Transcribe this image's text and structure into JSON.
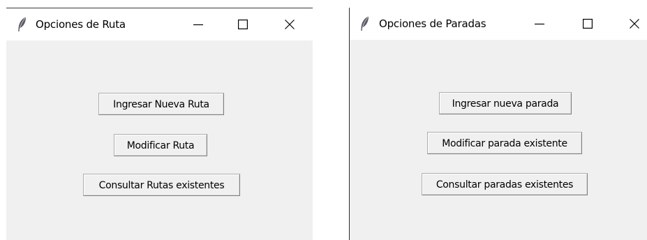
{
  "windows": [
    {
      "title": "Opciones de Ruta",
      "icon": "feather-icon",
      "controls": [
        "minimize-icon",
        "maximize-icon",
        "close-icon"
      ],
      "buttons": [
        {
          "label": "Ingresar Nueva Ruta"
        },
        {
          "label": "Modificar Ruta"
        },
        {
          "label": "Consultar Rutas existentes"
        }
      ]
    },
    {
      "title": "Opciones de Paradas",
      "icon": "feather-icon",
      "controls": [
        "minimize-icon",
        "maximize-icon",
        "close-icon"
      ],
      "buttons": [
        {
          "label": "Ingresar nueva parada"
        },
        {
          "label": "Modificar parada existente"
        },
        {
          "label": "Consultar paradas existentes"
        }
      ]
    }
  ],
  "colors": {
    "titlebar": "#ffffff",
    "client_area": "#f0f0f0",
    "button_face": "#f0f0f0",
    "button_border": "#adadad",
    "text": "#000000"
  }
}
